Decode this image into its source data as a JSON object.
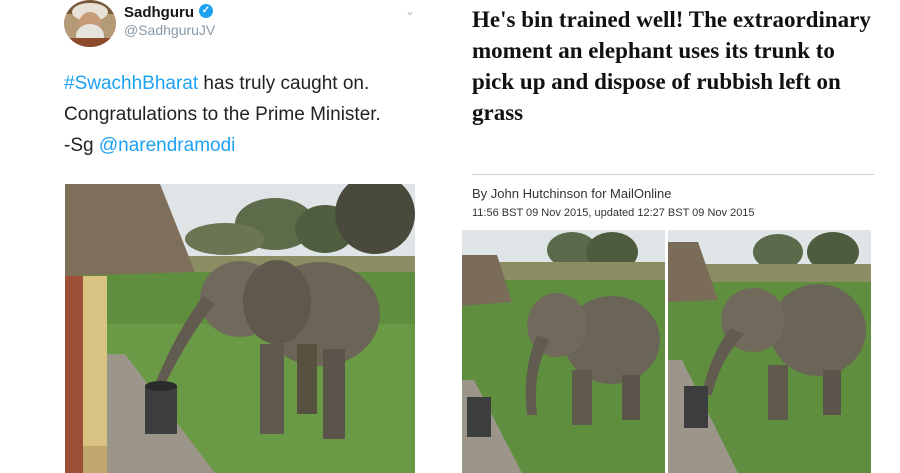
{
  "tweet": {
    "author_name": "Sadhguru",
    "author_handle": "@SadhguruJV",
    "verified_icon": "verified-badge-icon",
    "menu_icon": "chevron-down-icon",
    "text": {
      "hashtag": "#SwachhBharat",
      "line1_rest": " has truly caught on.",
      "line2": "Congratulations to the Prime Minister.",
      "line3_prefix": "-Sg ",
      "mention": "@narendramodi"
    },
    "colors": {
      "link": "#1da1f2",
      "handle": "#8899a6"
    }
  },
  "article": {
    "headline": "He's bin trained well! The extraordinary moment an elephant uses its trunk to pick up and dispose of rubbish left on grass",
    "byline": "By John Hutchinson for MailOnline",
    "dateline": "11:56 BST 09 Nov 2015, updated 12:27 BST 09 Nov 2015"
  }
}
